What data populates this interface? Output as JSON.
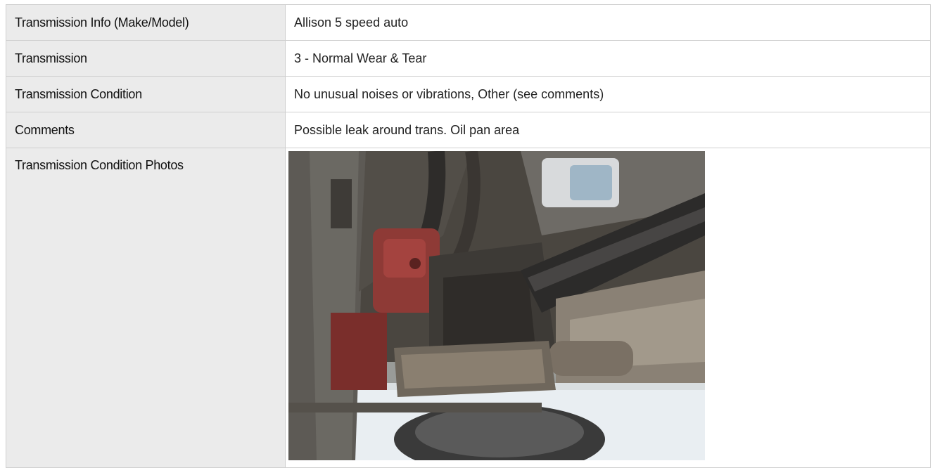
{
  "section": {
    "heading": ""
  },
  "rows": [
    {
      "label": "Transmission Info (Make/Model)",
      "value": "Allison 5 speed auto"
    },
    {
      "label": "Transmission",
      "value": "3 - Normal Wear & Tear"
    },
    {
      "label": "Transmission Condition",
      "value": "No unusual noises or vibrations, Other (see comments)"
    },
    {
      "label": "Comments",
      "value": "Possible leak around trans. Oil pan area"
    },
    {
      "label": "Transmission Condition Photos",
      "value": ""
    }
  ],
  "colors": {
    "heading": "#1a9ad6",
    "label_bg": "#ebebeb",
    "border": "#cfcfcf"
  }
}
